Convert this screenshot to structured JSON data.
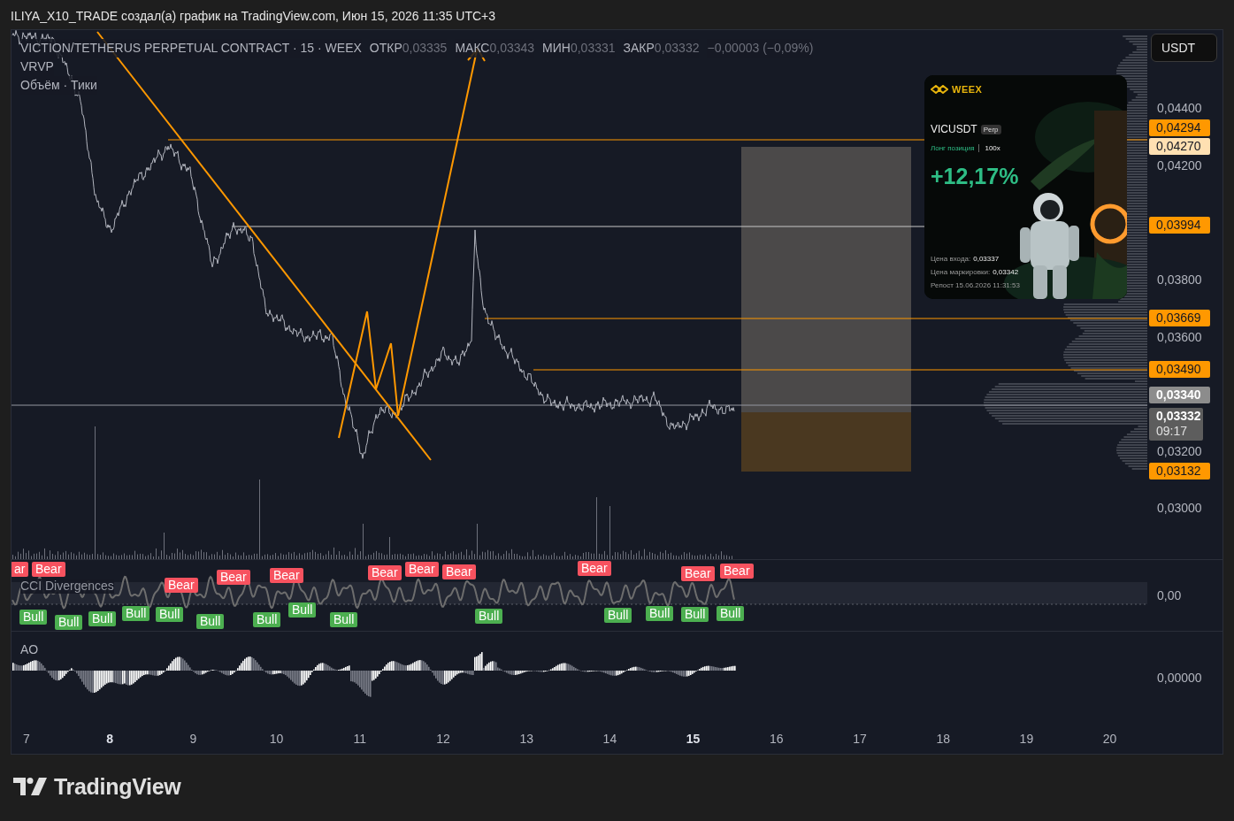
{
  "header": {
    "text": "ILIYA_X10_TRADE создал(а) график на TradingView.com, Июн 15, 2026 11:35 UTC+3"
  },
  "legend": {
    "symbol": "VICTION/TETHERUS PERPETUAL CONTRACT · 15 · WEEX",
    "ohlc": [
      {
        "label": "ОТКР",
        "value": "0,03335"
      },
      {
        "label": "МАКС",
        "value": "0,03343"
      },
      {
        "label": "МИН",
        "value": "0,03331"
      },
      {
        "label": "ЗАКР",
        "value": "0,03332"
      }
    ],
    "change": "−0,00003 (−0,09%)",
    "indicators": [
      "VRVP",
      "Объём · Тики"
    ]
  },
  "currency_button": "USDT",
  "price_axis": [
    {
      "kind": "tick",
      "label": "0,04400"
    },
    {
      "kind": "badge",
      "label": "0,04294",
      "color": "#ff9800"
    },
    {
      "kind": "badge",
      "label": "0,04270",
      "color": "#ffe0b2"
    },
    {
      "kind": "tick",
      "label": "0,04200"
    },
    {
      "kind": "badge",
      "label": "0,03994",
      "color": "#ff9800"
    },
    {
      "kind": "tick",
      "label": "0,03800"
    },
    {
      "kind": "badge",
      "label": "0,03669",
      "color": "#ff9800"
    },
    {
      "kind": "tick",
      "label": "0,03600"
    },
    {
      "kind": "badge",
      "label": "0,03490",
      "color": "#ff9800"
    },
    {
      "kind": "badge",
      "label": "0,03340",
      "color": "#8c8c8c"
    },
    {
      "kind": "badge",
      "label": "0,03332",
      "countdown": "09:17",
      "color": "#5d5d5d"
    },
    {
      "kind": "tick",
      "label": "0,03200"
    },
    {
      "kind": "badge",
      "label": "0,03132",
      "color": "#ff9800"
    },
    {
      "kind": "tick",
      "label": "0,03000"
    }
  ],
  "trade_card": {
    "brand": "WEEX",
    "symbol": "VICUSDT",
    "badge": "Perp",
    "position": "Лонг позиция",
    "leverage": "100x",
    "pnl": "+12,17%",
    "entry_label": "Цена входа:",
    "entry": "0,03337",
    "mark_label": "Цена маркировки:",
    "mark": "0,03342",
    "repost": "Репост 15.06.2026 11:31:53"
  },
  "cci": {
    "title": "CCI Divergences",
    "axis_label": "0,00",
    "signals": [
      {
        "kind": "bear",
        "label": "ar"
      },
      {
        "kind": "bear",
        "label": "Bear"
      },
      {
        "kind": "bear",
        "label": "Bear"
      },
      {
        "kind": "bear",
        "label": "Bear"
      },
      {
        "kind": "bear",
        "label": "Bear"
      },
      {
        "kind": "bear",
        "label": "Bear"
      },
      {
        "kind": "bear",
        "label": "Bear"
      },
      {
        "kind": "bear",
        "label": "Bear"
      },
      {
        "kind": "bear",
        "label": "Bear"
      },
      {
        "kind": "bear",
        "label": "Bear"
      },
      {
        "kind": "bear",
        "label": "Bear"
      },
      {
        "kind": "bull",
        "label": "Bull"
      },
      {
        "kind": "bull",
        "label": "Bull"
      },
      {
        "kind": "bull",
        "label": "Bull"
      },
      {
        "kind": "bull",
        "label": "Bull"
      },
      {
        "kind": "bull",
        "label": "Bull"
      },
      {
        "kind": "bull",
        "label": "Bull"
      },
      {
        "kind": "bull",
        "label": "Bull"
      },
      {
        "kind": "bull",
        "label": "Bull"
      },
      {
        "kind": "bull",
        "label": "Bull"
      },
      {
        "kind": "bull",
        "label": "Bull"
      },
      {
        "kind": "bull",
        "label": "Bull"
      },
      {
        "kind": "bull",
        "label": "Bull"
      },
      {
        "kind": "bull",
        "label": "Bull"
      },
      {
        "kind": "bull",
        "label": "Bull"
      }
    ]
  },
  "ao": {
    "title": "AO",
    "axis_label": "0,00000"
  },
  "time_axis": [
    {
      "label": "7",
      "emphasized": false
    },
    {
      "label": "8",
      "emphasized": true
    },
    {
      "label": "9",
      "emphasized": false
    },
    {
      "label": "10",
      "emphasized": false
    },
    {
      "label": "11",
      "emphasized": false
    },
    {
      "label": "12",
      "emphasized": false
    },
    {
      "label": "13",
      "emphasized": false
    },
    {
      "label": "14",
      "emphasized": false
    },
    {
      "label": "15",
      "emphasized": true
    },
    {
      "label": "16",
      "emphasized": false
    },
    {
      "label": "17",
      "emphasized": false
    },
    {
      "label": "18",
      "emphasized": false
    },
    {
      "label": "19",
      "emphasized": false
    },
    {
      "label": "20",
      "emphasized": false
    }
  ],
  "footer": {
    "brand": "TradingView"
  }
}
